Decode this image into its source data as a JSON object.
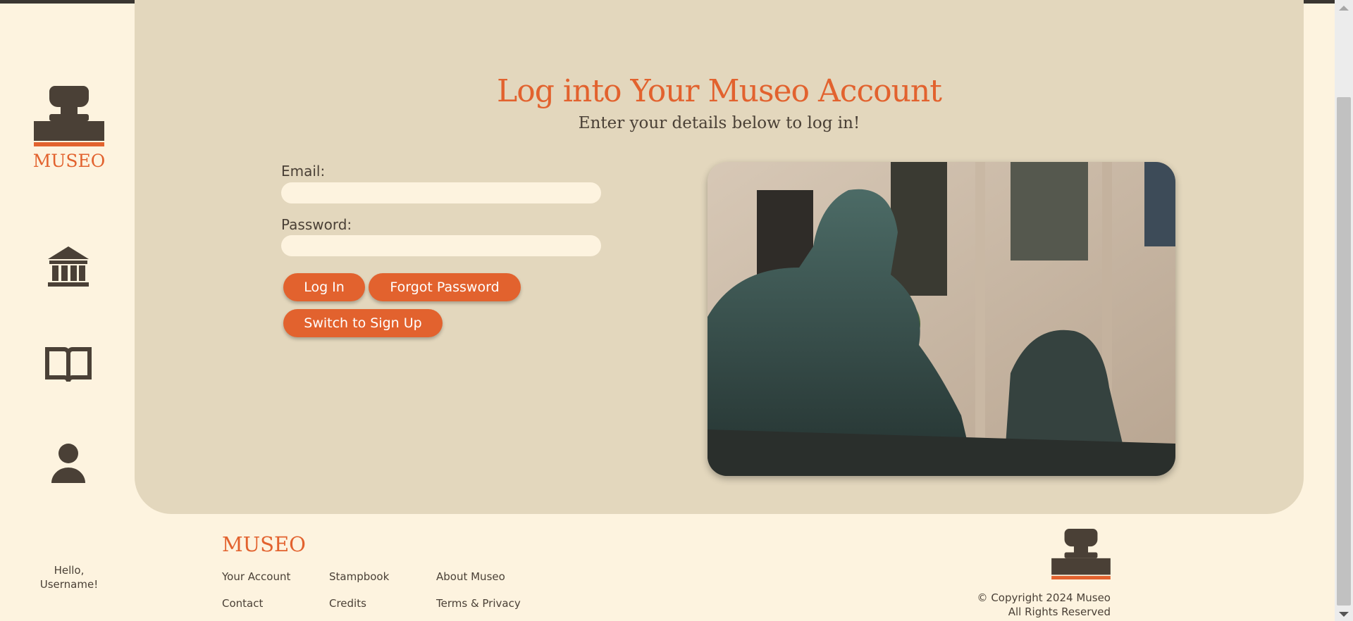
{
  "brand": {
    "name": "MUSEO",
    "accent": "#e2622e",
    "dark": "#4a4036"
  },
  "sidebar": {
    "items": [
      {
        "icon": "museum-icon"
      },
      {
        "icon": "book-icon"
      },
      {
        "icon": "user-icon"
      }
    ],
    "greeting": "Hello, Username!"
  },
  "login": {
    "title": "Log into Your Museo Account",
    "subtitle": "Enter your details below to log in!",
    "email_label": "Email:",
    "email_value": "",
    "password_label": "Password:",
    "password_value": "",
    "login_button": "Log In",
    "forgot_button": "Forgot Password",
    "switch_button": "Switch to Sign Up"
  },
  "footer": {
    "logo": "MUSEO",
    "links": [
      "Your Account",
      "Stampbook",
      "About Museo",
      "Contact",
      "Credits",
      "Terms & Privacy"
    ],
    "copyright_line1": "© Copyright 2024 Museo",
    "copyright_line2": "All Rights Reserved"
  }
}
